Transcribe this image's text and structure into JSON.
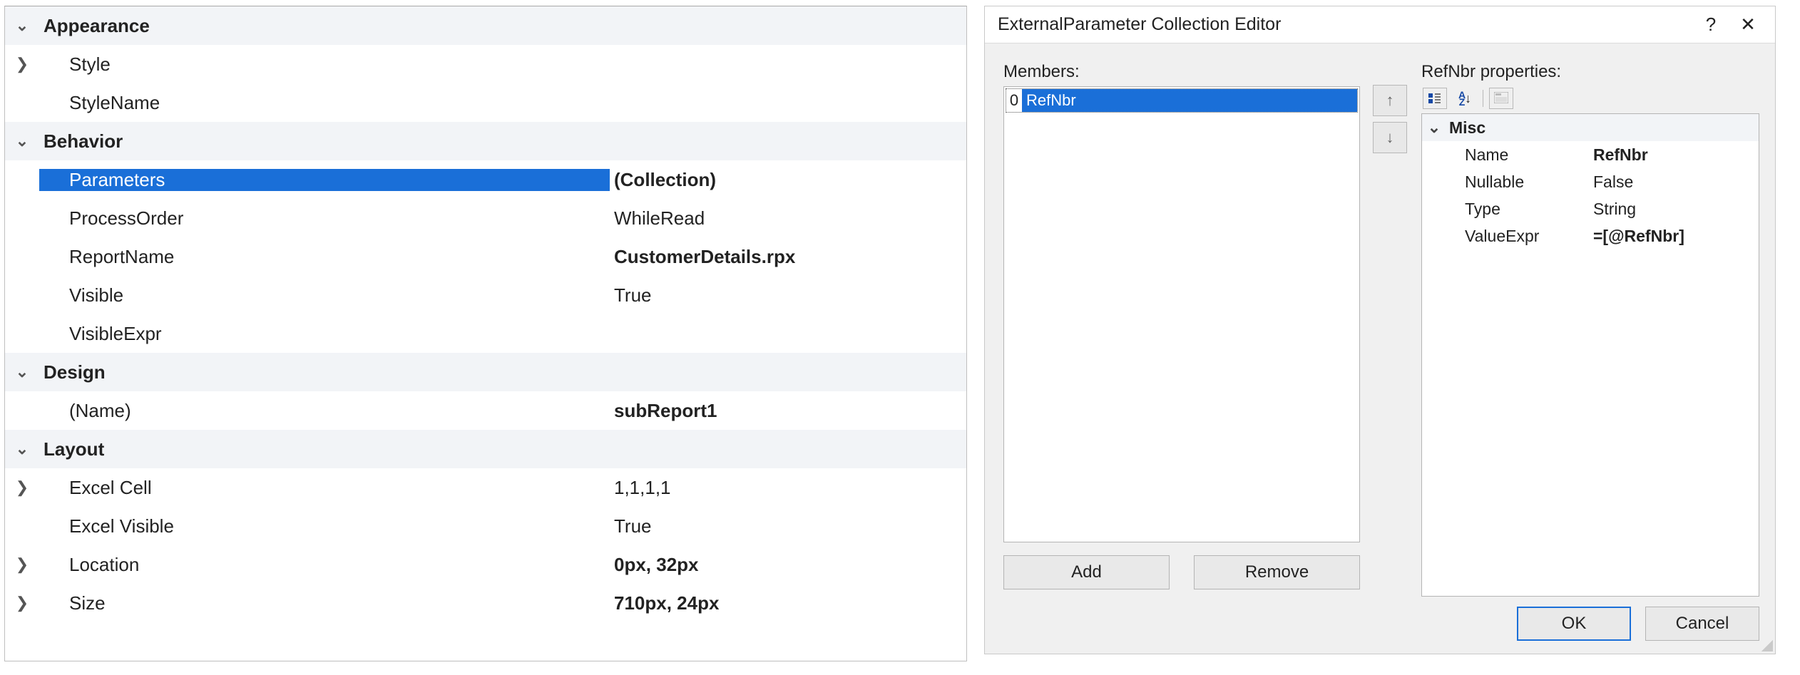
{
  "propgrid": {
    "categories": {
      "appearance": "Appearance",
      "behavior": "Behavior",
      "design": "Design",
      "layout": "Layout"
    },
    "appearance": {
      "style": {
        "label": "Style",
        "value": ""
      },
      "styleName": {
        "label": "StyleName",
        "value": ""
      }
    },
    "behavior": {
      "parameters": {
        "label": "Parameters",
        "value": "(Collection)"
      },
      "processOrder": {
        "label": "ProcessOrder",
        "value": "WhileRead"
      },
      "reportName": {
        "label": "ReportName",
        "value": "CustomerDetails.rpx"
      },
      "visible": {
        "label": "Visible",
        "value": "True"
      },
      "visibleExpr": {
        "label": "VisibleExpr",
        "value": ""
      }
    },
    "design": {
      "name": {
        "label": "(Name)",
        "value": "subReport1"
      }
    },
    "layout": {
      "excelCell": {
        "label": "Excel Cell",
        "value": "1,1,1,1"
      },
      "excelVisible": {
        "label": "Excel Visible",
        "value": "True"
      },
      "location": {
        "label": "Location",
        "value": "0px, 32px"
      },
      "size": {
        "label": "Size",
        "value": "710px, 24px"
      }
    }
  },
  "dialog": {
    "title": "ExternalParameter Collection Editor",
    "membersLabel": "Members:",
    "propsLabel": "RefNbr properties:",
    "members": [
      {
        "index": "0",
        "name": "RefNbr"
      }
    ],
    "buttons": {
      "add": "Add",
      "remove": "Remove",
      "ok": "OK",
      "cancel": "Cancel"
    },
    "propgrid": {
      "category": "Misc",
      "rows": {
        "name": {
          "label": "Name",
          "value": "RefNbr"
        },
        "nullable": {
          "label": "Nullable",
          "value": "False"
        },
        "type": {
          "label": "Type",
          "value": "String"
        },
        "valueExpr": {
          "label": "ValueExpr",
          "value": "=[@RefNbr]"
        }
      }
    }
  }
}
